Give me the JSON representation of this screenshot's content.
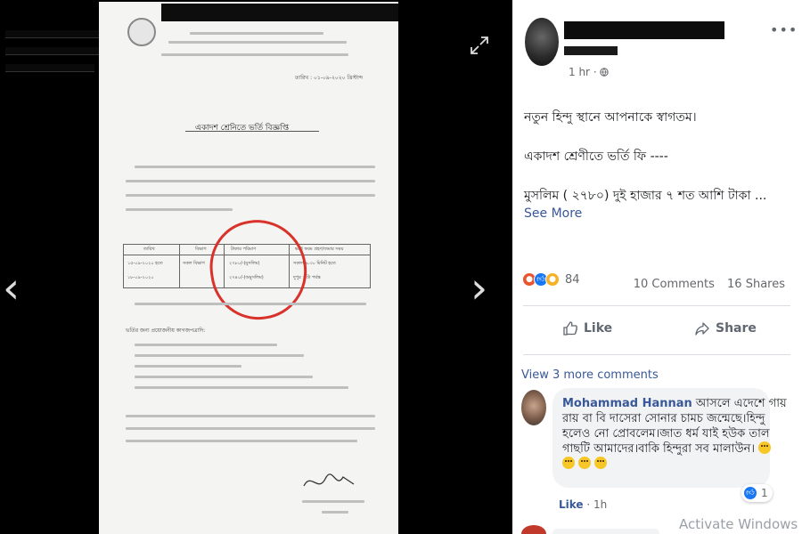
{
  "viewer": {
    "document": {
      "date_line": "তারিখ : ০১-০৯-২০২০ খ্রিস্টাব্দ",
      "title": "একাদশ শ্রেনিতে ভর্তি বিজ্ঞপ্তি",
      "table": {
        "headers": [
          "তারিখ",
          "বিভাগ",
          "টাকার পরিমাণ",
          "ভর্তি ফরম গ্রহণ/জমার সময়"
        ],
        "date_cells": [
          "১৫-০৯-২০২০ হতে",
          "১৮-০৯-২০২০"
        ],
        "dept_cell": "সকল বিভাগ",
        "amount_cells": [
          "২৭৮০/-(মুসলিম)",
          "২৭৪০/-(অমুসলিম)"
        ],
        "time_cells": [
          "সকাল ৯.৩০ মিনিট হতে",
          "দুপুর ২ টা পর্যন্ত"
        ]
      },
      "section_heading": "ভর্তির জন্য প্রয়োজনীয় কাগজপত্রাদি:"
    }
  },
  "post": {
    "time": "1 hr",
    "lines": [
      "নতুন হিন্দু স্থানে আপনাকে স্বাগতম।",
      "একাদশ শ্রেণীতে ভর্তি ফি ----",
      "মুসলিম ( ২৭৮০) দুই হাজার ৭ শত আশি টাকা ..."
    ],
    "see_more": "See More",
    "reaction_count": "84",
    "comments_count": "10 Comments",
    "shares_count": "16 Shares",
    "like_label": "Like",
    "share_label": "Share"
  },
  "comments": {
    "view_more": "View 3 more comments",
    "items": [
      {
        "author": "Mohammad Hannan",
        "text_lines": [
          "আসলে এদেশে গায়",
          "রায় বা বি দাসেরা সোনার চামচ জন্মেছে।হিন্দু",
          "হলেও নো প্রোবলেম।জাত ধর্ম যাই হউক তাল",
          "গাছটি আমাদের।বাকি হিন্দুরা সব মালাউন।"
        ],
        "reaction_count": "1",
        "like_label": "Like",
        "time": "1h"
      }
    ]
  },
  "watermark": "Activate Windows",
  "colors": {
    "link": "#385898",
    "secondary_text": "#65676b",
    "circle_mark": "#d9322a"
  }
}
